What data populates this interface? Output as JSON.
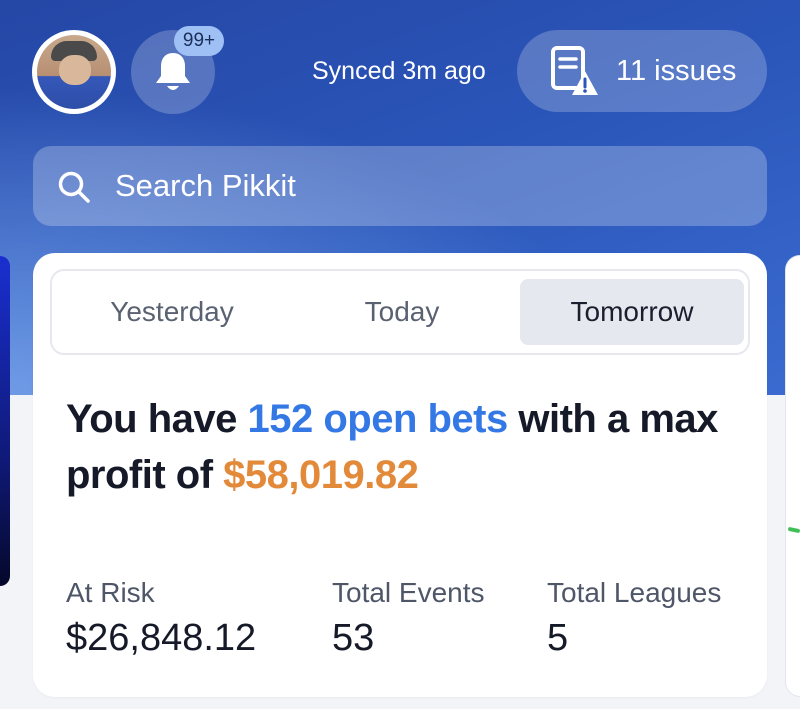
{
  "header": {
    "notification_badge": "99+",
    "sync_status": "Synced 3m ago",
    "issues_label": "11 issues"
  },
  "search": {
    "placeholder": "Search Pikkit"
  },
  "tabs": [
    {
      "label": "Yesterday",
      "active": false
    },
    {
      "label": "Today",
      "active": false
    },
    {
      "label": "Tomorrow",
      "active": true
    }
  ],
  "summary": {
    "prefix": "You have ",
    "open_bets": "152 open bets",
    "middle": " with a max profit of ",
    "max_profit": "$58,019.82"
  },
  "stats": [
    {
      "label": "At Risk",
      "value": "$26,848.12"
    },
    {
      "label": "Total Events",
      "value": "53"
    },
    {
      "label": "Total Leagues",
      "value": "5"
    }
  ],
  "colors": {
    "accent_blue": "#3478e6",
    "accent_orange": "#e38a3a",
    "header_bg": "#2a55b8"
  },
  "icons": [
    "avatar",
    "bell-icon",
    "issues-report-icon",
    "search-icon"
  ]
}
